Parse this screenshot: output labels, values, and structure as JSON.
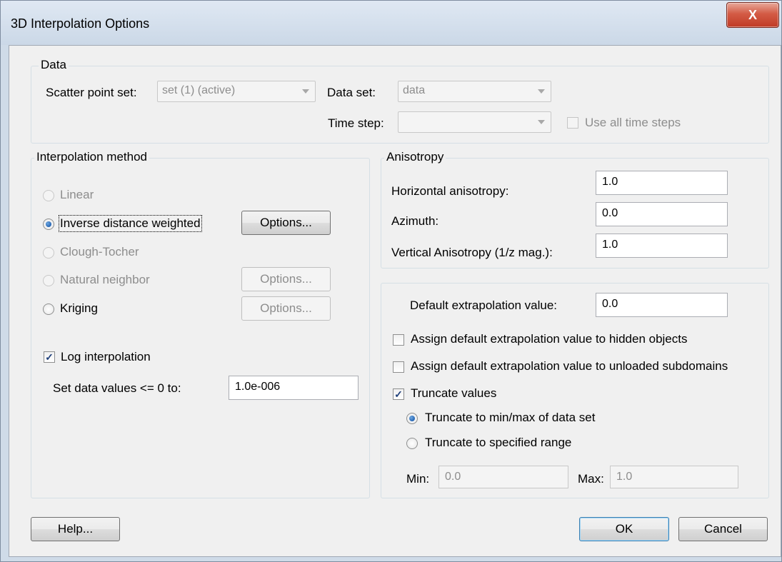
{
  "window": {
    "title": "3D Interpolation Options",
    "close_symbol": "X"
  },
  "data_group": {
    "label": "Data",
    "scatter_point_set_label": "Scatter point set:",
    "scatter_point_set_value": "set (1) (active)",
    "data_set_label": "Data set:",
    "data_set_value": "data",
    "time_step_label": "Time step:",
    "time_step_value": "",
    "use_all_time_steps_label": "Use all time steps",
    "use_all_time_steps_checked": false
  },
  "interpolation": {
    "label": "Interpolation method",
    "methods": [
      {
        "label": "Linear",
        "enabled": false,
        "selected": false
      },
      {
        "label": "Inverse distance weighted",
        "enabled": true,
        "selected": true
      },
      {
        "label": "Clough-Tocher",
        "enabled": false,
        "selected": false
      },
      {
        "label": "Natural neighbor",
        "enabled": false,
        "selected": false
      },
      {
        "label": "Kriging",
        "enabled": true,
        "selected": false
      }
    ],
    "options_label": "Options...",
    "log_interpolation_label": "Log interpolation",
    "log_interpolation_checked": true,
    "set_data_values_label": "Set data values <= 0 to:",
    "set_data_values_value": "1.0e-006"
  },
  "anisotropy": {
    "label": "Anisotropy",
    "horizontal_label": "Horizontal anisotropy:",
    "horizontal_value": "1.0",
    "azimuth_label": "Azimuth:",
    "azimuth_value": "0.0",
    "vertical_label": "Vertical Anisotropy (1/z mag.):",
    "vertical_value": "1.0"
  },
  "extrapolation": {
    "default_label": "Default extrapolation value:",
    "default_value": "0.0",
    "assign_hidden_label": "Assign default extrapolation value to hidden objects",
    "assign_hidden_checked": false,
    "assign_unloaded_label": "Assign default extrapolation value to unloaded subdomains",
    "assign_unloaded_checked": false,
    "truncate_label": "Truncate values",
    "truncate_checked": true,
    "truncate_minmax_label": "Truncate to min/max of data set",
    "truncate_range_label": "Truncate to specified range",
    "min_label": "Min:",
    "min_value": "0.0",
    "max_label": "Max:",
    "max_value": "1.0"
  },
  "buttons": {
    "help": "Help...",
    "ok": "OK",
    "cancel": "Cancel"
  },
  "symbols": {
    "check": "✓"
  }
}
